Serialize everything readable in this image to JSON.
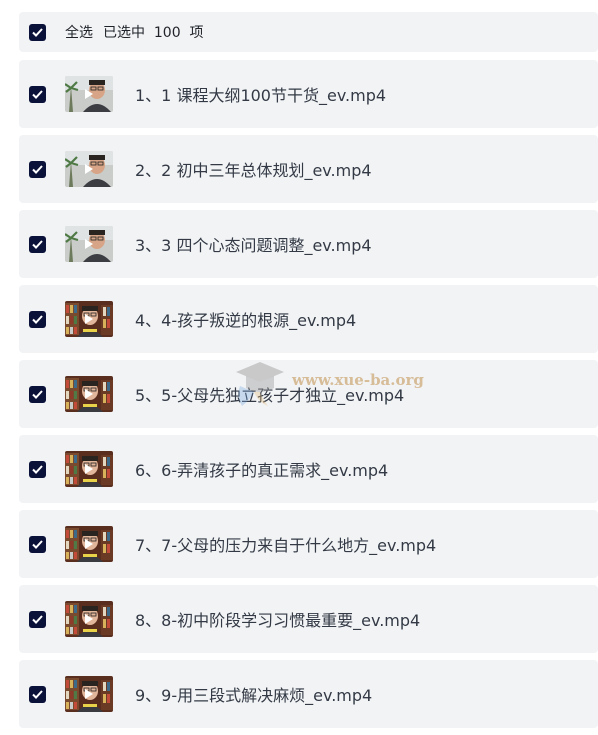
{
  "header": {
    "select_all": "全选",
    "selected_text": "已选中  100  项"
  },
  "items": [
    {
      "label": "1、1 课程大纲100节干货_ev.mp4",
      "thumb": "outdoor"
    },
    {
      "label": "2、2 初中三年总体规划_ev.mp4",
      "thumb": "outdoor"
    },
    {
      "label": "3、3 四个心态问题调整_ev.mp4",
      "thumb": "outdoor"
    },
    {
      "label": "4、4-孩子叛逆的根源_ev.mp4",
      "thumb": "bookshelf"
    },
    {
      "label": "5、5-父母先独立孩子才独立_ev.mp4",
      "thumb": "bookshelf"
    },
    {
      "label": "6、6-弄清孩子的真正需求_ev.mp4",
      "thumb": "bookshelf"
    },
    {
      "label": "7、7-父母的压力来自于什么地方_ev.mp4",
      "thumb": "bookshelf"
    },
    {
      "label": "8、8-初中阶段学习习惯最重要_ev.mp4",
      "thumb": "bookshelf"
    },
    {
      "label": "9、9-用三段式解决麻烦_ev.mp4",
      "thumb": "bookshelf"
    }
  ],
  "watermark": {
    "text": "www.xue-ba.org"
  },
  "colors": {
    "checkbox": "#0b1239",
    "row_bg": "#f2f3f5",
    "text": "#333a45"
  }
}
